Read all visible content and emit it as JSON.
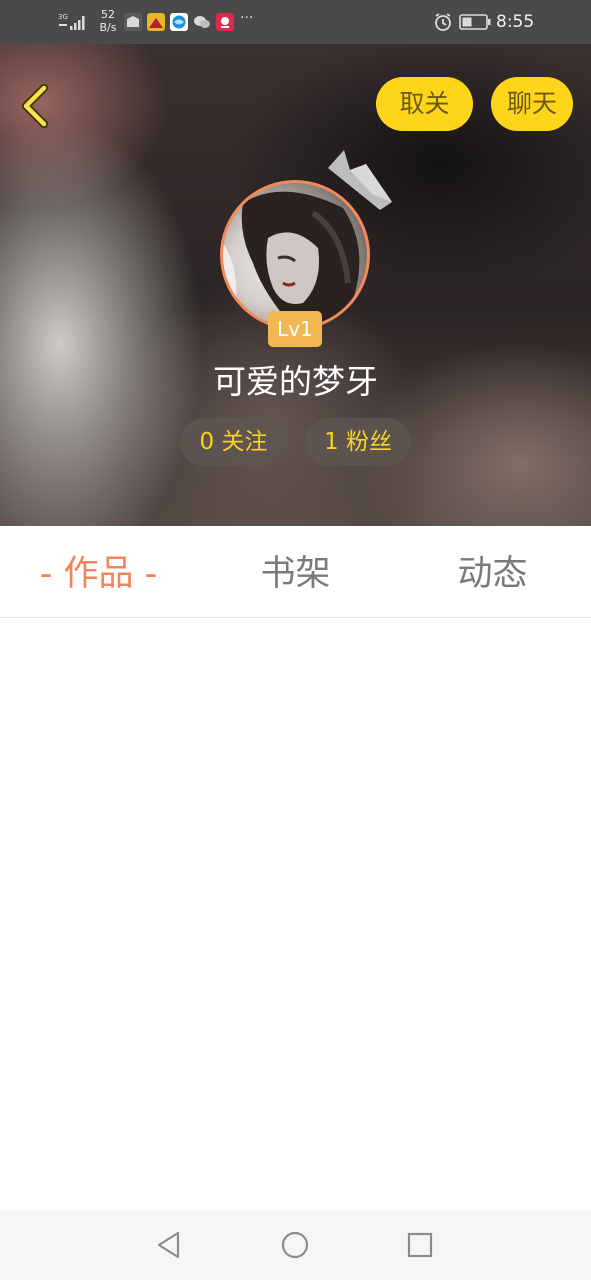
{
  "status_bar": {
    "network_speed": "52",
    "network_speed_unit": "B/s",
    "network_type": "3G",
    "more_indicator": "···",
    "time": "8:55",
    "icons": [
      "signal-icon",
      "app-icon-1",
      "app-icon-2",
      "app-icon-3",
      "wechat-icon",
      "app-icon-5",
      "alarm-icon",
      "battery-icon"
    ]
  },
  "header": {
    "unfollow_label": "取关",
    "chat_label": "聊天",
    "level": "Lv1",
    "username": "可爱的梦牙",
    "follow_stat": "0 关注",
    "fan_stat": "1 粉丝"
  },
  "tabs": [
    {
      "label": "作品",
      "active": true
    },
    {
      "label": "书架",
      "active": false
    },
    {
      "label": "动态",
      "active": false
    }
  ],
  "tab_active_dash": "-",
  "colors": {
    "accent_yellow": "#ffd51a",
    "active_tab": "#f0855a",
    "avatar_ring": "#f28a5a",
    "level_badge": "#f1b852",
    "stat_text": "#f7d41e"
  }
}
